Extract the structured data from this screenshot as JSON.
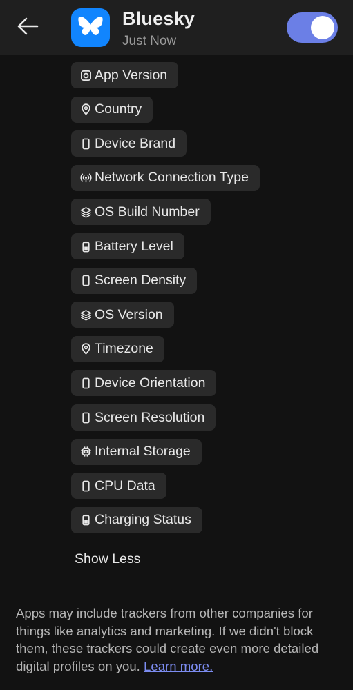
{
  "header": {
    "app_name": "Bluesky",
    "time": "Just Now",
    "toggle_on": true,
    "toggle_color": "#6b7fe6",
    "app_icon_color": "#1185fe"
  },
  "data_types": [
    {
      "label": "App Version",
      "icon": "app-version-icon"
    },
    {
      "label": "Country",
      "icon": "location-pin-icon"
    },
    {
      "label": "Device Brand",
      "icon": "phone-icon"
    },
    {
      "label": "Network Connection Type",
      "icon": "signal-icon"
    },
    {
      "label": "OS Build Number",
      "icon": "layers-icon"
    },
    {
      "label": "Battery Level",
      "icon": "battery-icon"
    },
    {
      "label": "Screen Density",
      "icon": "phone-icon"
    },
    {
      "label": "OS Version",
      "icon": "layers-icon"
    },
    {
      "label": "Timezone",
      "icon": "location-pin-icon"
    },
    {
      "label": "Device Orientation",
      "icon": "phone-icon"
    },
    {
      "label": "Screen Resolution",
      "icon": "phone-icon"
    },
    {
      "label": "Internal Storage",
      "icon": "chip-icon"
    },
    {
      "label": "CPU Data",
      "icon": "phone-icon"
    },
    {
      "label": "Charging Status",
      "icon": "battery-icon"
    }
  ],
  "show_less_label": "Show Less",
  "footer": {
    "text": "Apps may include trackers from other companies for things like analytics and marketing. If we didn't block them, these trackers could create even more detailed digital profiles on you.",
    "link": "Learn more."
  }
}
